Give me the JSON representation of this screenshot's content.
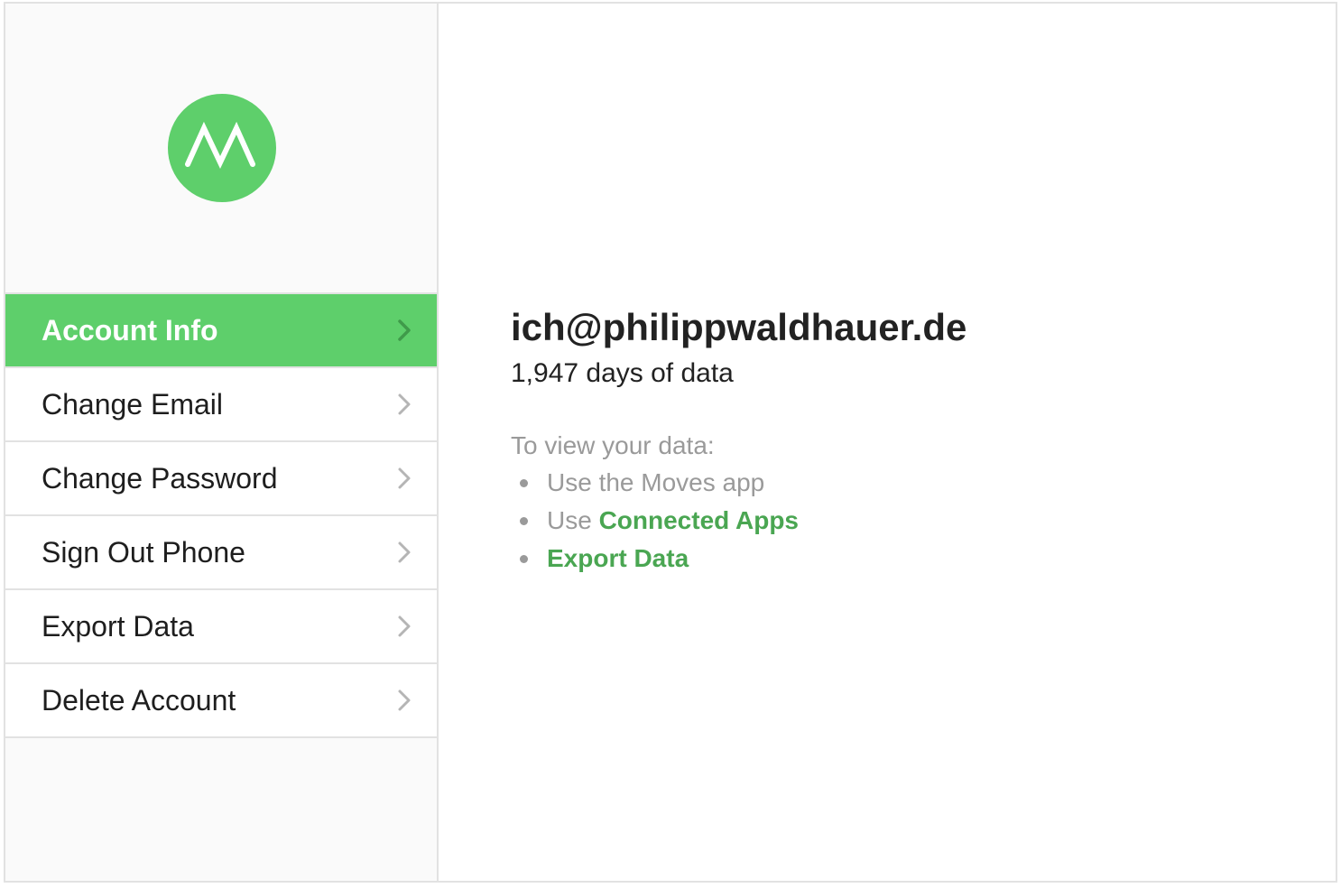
{
  "brand": {
    "logo_icon": "moves-logo-icon",
    "accent_color": "#5ecf6b",
    "link_color": "#4aa652"
  },
  "sidebar": {
    "items": [
      {
        "label": "Account Info",
        "active": true
      },
      {
        "label": "Change Email",
        "active": false
      },
      {
        "label": "Change Password",
        "active": false
      },
      {
        "label": "Sign Out Phone",
        "active": false
      },
      {
        "label": "Export Data",
        "active": false
      },
      {
        "label": "Delete Account",
        "active": false
      }
    ],
    "item_icon": "chevron-right-icon"
  },
  "account": {
    "email": "ich@philippwaldhauer.de",
    "days_of_data": "1,947 days of data"
  },
  "view_data": {
    "title": "To view your data:",
    "items": [
      {
        "text": "Use the Moves app"
      },
      {
        "prefix": "Use ",
        "link": "Connected Apps"
      },
      {
        "link": "Export Data"
      }
    ]
  }
}
